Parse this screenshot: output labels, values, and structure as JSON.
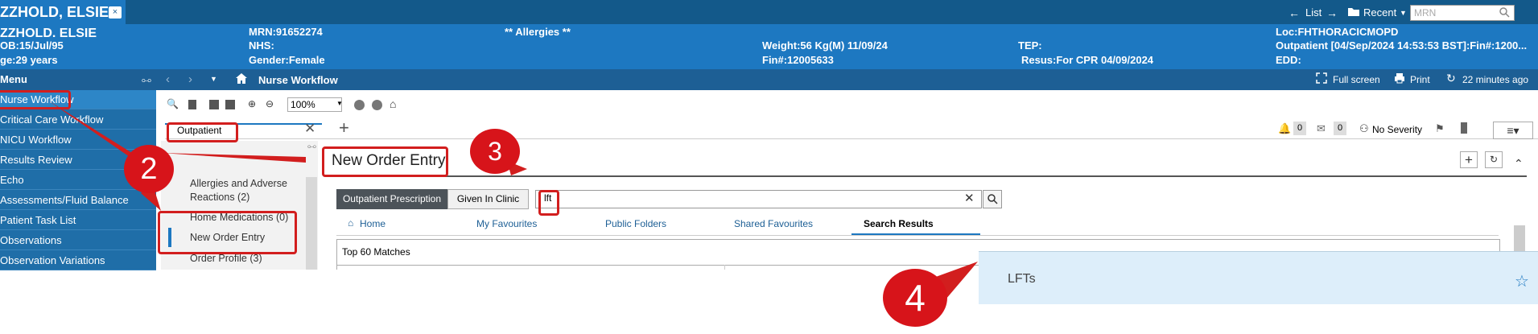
{
  "patient": {
    "tab_name": "ZZHOLD, ELSIE",
    "tab_close": "×",
    "name": "ZZHOLD. ELSIE",
    "dob": "OB:15/Jul/95",
    "age": "ge:29 years",
    "mrn": "MRN:91652274",
    "nhs": "NHS:",
    "gender": "Gender:Female",
    "allergies": "** Allergies **",
    "weight": "Weight:56 Kg(M) 11/09/24",
    "fin": "Fin#:12005633",
    "tep": "TEP:",
    "resus": "Resus:For CPR  04/09/2024",
    "loc": "Loc:FHTHORACICMOPD",
    "outpatient": "Outpatient [04/Sep/2024 14:53:53 BST]:Fin#:1200...",
    "edd": "EDD:"
  },
  "topbar": {
    "list_label": "List",
    "recent_label": "Recent",
    "mrn_placeholder": "MRN"
  },
  "toolbar": {
    "menu_label": "Menu",
    "page_title": "Nurse Workflow",
    "fullscreen": "Full screen",
    "print": "Print",
    "refreshed": "22 minutes ago",
    "zoom": "100%"
  },
  "sidebar": {
    "items": [
      {
        "label": "Nurse Workflow"
      },
      {
        "label": "Critical Care Workflow"
      },
      {
        "label": "NICU Workflow"
      },
      {
        "label": "Results Review"
      },
      {
        "label": "Echo"
      },
      {
        "label": "Assessments/Fluid Balance"
      },
      {
        "label": "Patient Task List"
      },
      {
        "label": "Observations"
      },
      {
        "label": "Observation Variations"
      }
    ]
  },
  "workflow": {
    "tab_outpatient": "Outpatient",
    "add_tab": "+",
    "severity": "No Severity",
    "count_bell": "0",
    "count_inbox": "0"
  },
  "leftnav": {
    "items": [
      {
        "label": "Allergies and Adverse Reactions (2)"
      },
      {
        "label": "Home Medications (0)"
      },
      {
        "label": "New Order Entry"
      },
      {
        "label": "Order Profile (3)"
      }
    ]
  },
  "order_entry": {
    "title": "New Order Entry",
    "tab_outpatient_rx": "Outpatient Prescription",
    "tab_given_in_clinic": "Given In Clinic",
    "search_value": "lft",
    "nav_home": "Home",
    "nav_favourites": "My Favourites",
    "nav_public": "Public Folders",
    "nav_shared": "Shared Favourites",
    "nav_results": "Search Results",
    "matches": "Top 60 Matches",
    "result_item": "LFTs"
  },
  "annotations": {
    "step2": "2",
    "step3": "3",
    "step4": "4"
  },
  "colors": {
    "banner": "#1d78c1",
    "topbar": "#13598a",
    "sidebar": "#1f6ea8",
    "annotation_red": "#d21e1e",
    "popup": "#ddeefa"
  }
}
